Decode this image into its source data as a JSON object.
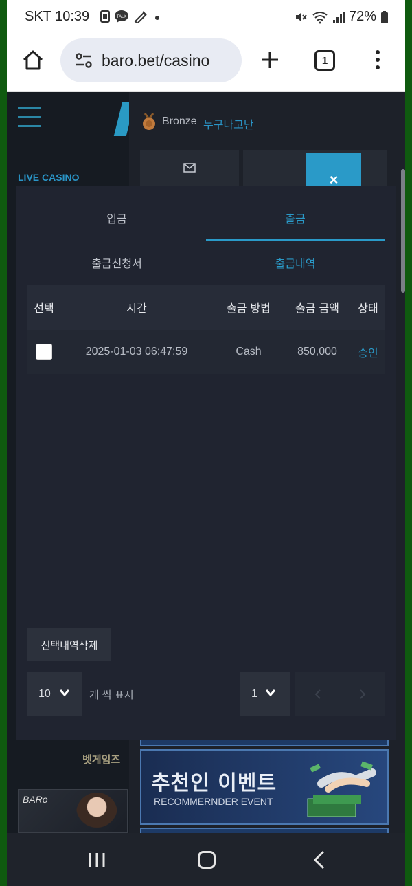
{
  "status_bar": {
    "carrier_time": "SKT 10:39",
    "notification_icons": [
      "sim-icon",
      "kakaotalk-icon",
      "pen-icon",
      "dot-icon"
    ],
    "status_icons": [
      "mute-icon",
      "wifi-icon",
      "signal-icon",
      "battery-icon"
    ],
    "battery": "72%"
  },
  "browser": {
    "url": "baro.bet/casino",
    "tab_count": "1"
  },
  "site": {
    "live_casino": "LIVE CASINO",
    "rank": "Bronze",
    "nickname": "누구나고난",
    "banner_title": "추천인 이벤트",
    "banner_subtitle": "RECOMMERNDER EVENT",
    "left_game_text": "벳게임즈",
    "left_tile_logo": "BARo"
  },
  "modal": {
    "close_label": "×",
    "tabs": [
      {
        "label": "입금",
        "active": false
      },
      {
        "label": "출금",
        "active": true
      }
    ],
    "subtabs": [
      {
        "label": "출금신청서",
        "active": false
      },
      {
        "label": "출금내역",
        "active": true
      }
    ],
    "table": {
      "headers": [
        "선택",
        "시간",
        "출금 방법",
        "출금 금액",
        "상태"
      ],
      "rows": [
        {
          "checked": false,
          "time": "2025-01-03 06:47:59",
          "method": "Cash",
          "amount": "850,000",
          "status": "승인"
        }
      ]
    },
    "delete_button": "선택내역삭제",
    "per_page_value": "10",
    "per_page_label": "개 씩 표시",
    "page_value": "1"
  },
  "colors": {
    "accent": "#2a9ac8",
    "modal_bg": "#202430",
    "frame_green": "#0f5a0f"
  }
}
